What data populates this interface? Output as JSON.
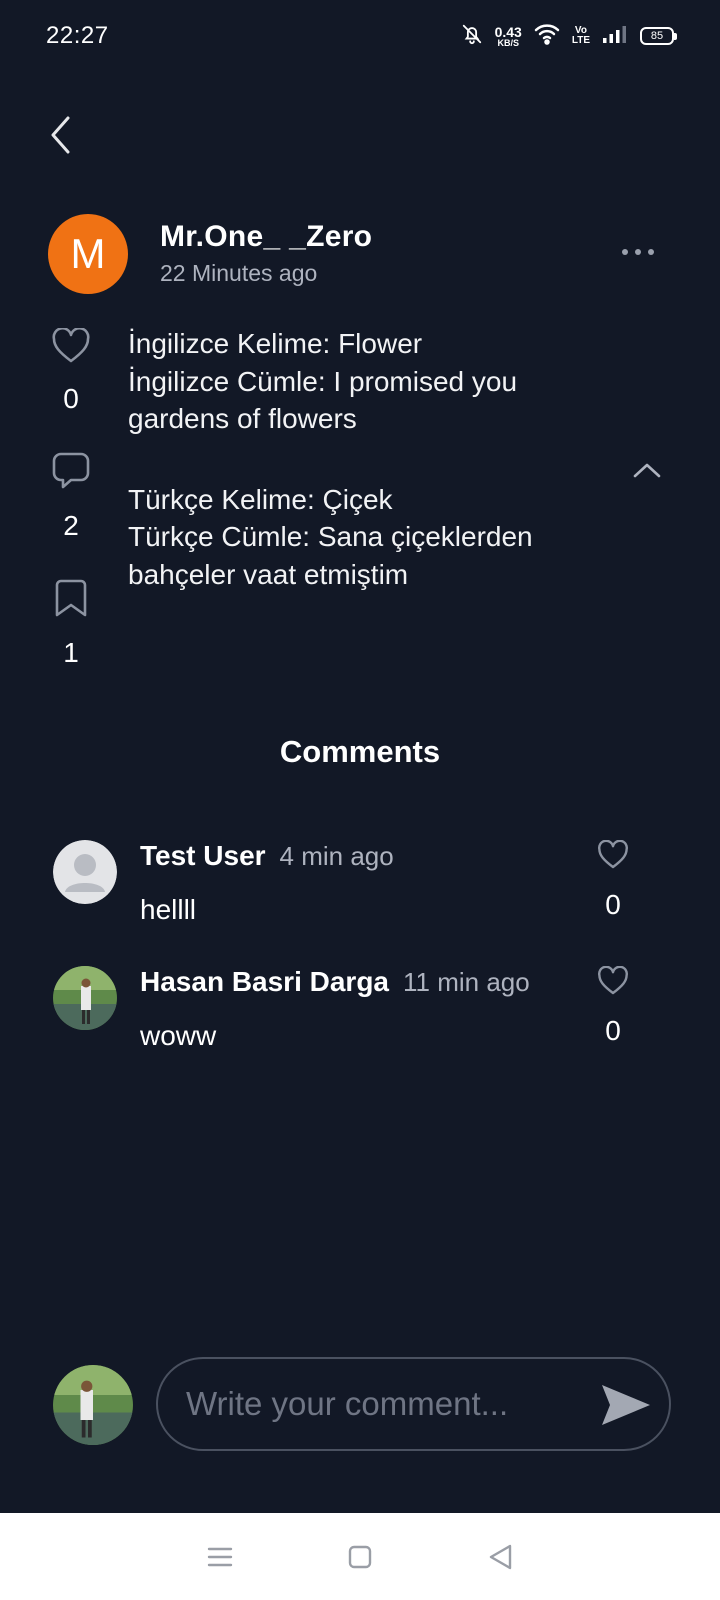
{
  "status_bar": {
    "time": "22:27",
    "speed_value": "0.43",
    "speed_unit": "KB/S",
    "volte_top": "Vo",
    "volte_bottom": "LTE",
    "battery": "85",
    "icons": [
      "bell-off-icon",
      "wifi-icon",
      "signal-icon",
      "battery-icon"
    ]
  },
  "post": {
    "avatar_letter": "M",
    "avatar_color": "#f07214",
    "author": "Mr.One_ _Zero",
    "time": "22 Minutes ago",
    "paragraphs": [
      [
        "İngilizce Kelime: Flower",
        "İngilizce Cümle: I promised you",
        "gardens of flowers"
      ],
      [
        "Türkçe Kelime: Çiçek",
        "Türkçe Cümle: Sana çiçeklerden",
        "bahçeler vaat etmiştim"
      ]
    ],
    "likes": "0",
    "comments": "2",
    "saves": "1"
  },
  "comments_section": {
    "title": "Comments",
    "items": [
      {
        "user": "Test User",
        "time": "4 min ago",
        "text": "hellll",
        "likes": "0",
        "avatar": "default-avatar"
      },
      {
        "user": "Hasan Basri Darga",
        "time": "11 min ago",
        "text": "woww",
        "likes": "0",
        "avatar": "photo-avatar"
      }
    ]
  },
  "comment_input": {
    "placeholder": "Write your comment..."
  },
  "colors": {
    "background": "#121826",
    "accent": "#f07214",
    "muted_text": "#aeb3bf"
  }
}
